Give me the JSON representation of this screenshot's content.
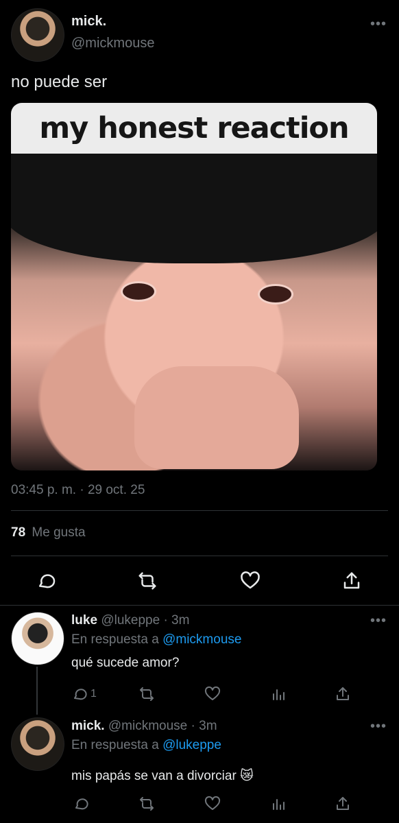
{
  "tweet": {
    "display_name": "mick.",
    "handle": "@mickmouse",
    "text": "no puede ser",
    "media_caption": "my honest reaction",
    "timestamp": "03:45 p. m. · 29 oct. 25",
    "likes_count": "78",
    "likes_label": "Me gusta",
    "more_icon": "more-horizontal-icon"
  },
  "replies": [
    {
      "display_name": "luke",
      "handle": "@lukeppe",
      "time": "· 3m",
      "in_reply_prefix": "En respuesta a",
      "in_reply_to": "@mickmouse",
      "text": "qué sucede amor?",
      "reply_count": "1"
    },
    {
      "display_name": "mick.",
      "handle": "@mickmouse",
      "time": "· 3m",
      "in_reply_prefix": "En respuesta a",
      "in_reply_to": "@lukeppe",
      "text": "mis papás se van a divorciar 😿"
    }
  ],
  "colors": {
    "background": "#000000",
    "text": "#e7e9ea",
    "muted": "#71767b",
    "link": "#1d9bf0",
    "divider": "#2f3336"
  }
}
